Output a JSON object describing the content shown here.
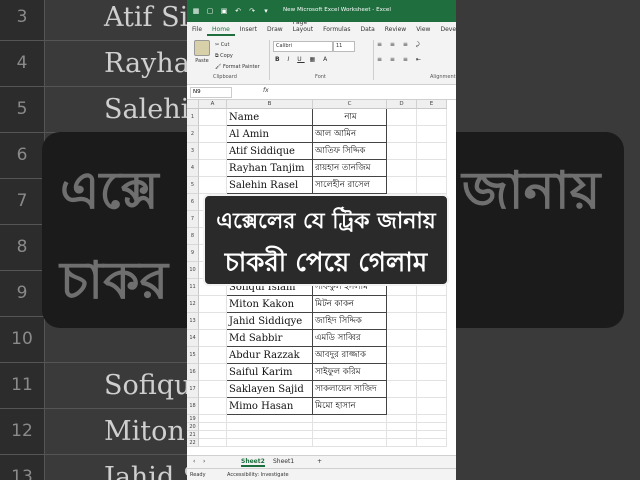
{
  "window": {
    "title": "New Microsoft Excel Worksheet - Excel",
    "menu": [
      "File",
      "Home",
      "Insert",
      "Draw",
      "Page Layout",
      "Formulas",
      "Data",
      "Review",
      "View",
      "Develo"
    ],
    "active_menu": "Home"
  },
  "ribbon": {
    "paste": "Paste",
    "cut": "Cut",
    "copy": "Copy",
    "format_painter": "Format Painter",
    "clipboard_label": "Clipboard",
    "font_name": "Calibri",
    "font_size": "11",
    "font_label": "Font",
    "alignment_label": "Alignment"
  },
  "formula_bar": {
    "name_box": "N9",
    "fx": "fx",
    "value": ""
  },
  "columns": [
    "A",
    "B",
    "C",
    "D",
    "E"
  ],
  "rows": [
    {
      "n": "1",
      "name": "Name",
      "bn": "নাম"
    },
    {
      "n": "2",
      "name": "Al Amin",
      "bn": "আল আমিন"
    },
    {
      "n": "3",
      "name": "Atif Siddique",
      "bn": "আতিফ সিদ্দিক"
    },
    {
      "n": "4",
      "name": "Rayhan Tanjim",
      "bn": "রায়হান তানজিম"
    },
    {
      "n": "5",
      "name": "Salehin Rasel",
      "bn": "সালেহীন রাসেল"
    },
    {
      "n": "6",
      "name": "",
      "bn": ""
    },
    {
      "n": "7",
      "name": "",
      "bn": ""
    },
    {
      "n": "8",
      "name": "",
      "bn": ""
    },
    {
      "n": "9",
      "name": "",
      "bn": ""
    },
    {
      "n": "10",
      "name": "",
      "bn": ""
    },
    {
      "n": "11",
      "name": "Sofiqul Islam",
      "bn": "সফিকুল ইসলাম"
    },
    {
      "n": "12",
      "name": "Miton Kakon",
      "bn": "মিটন কাকন"
    },
    {
      "n": "13",
      "name": "Jahid Siddiqye",
      "bn": "জাহিদ সিদ্দিক"
    },
    {
      "n": "14",
      "name": "Md Sabbir",
      "bn": "এমডি সাব্বির"
    },
    {
      "n": "15",
      "name": "Abdur Razzak",
      "bn": "আবদুর রাজ্জাক"
    },
    {
      "n": "16",
      "name": "Saiful Karim",
      "bn": "সাইফুল করিম"
    },
    {
      "n": "17",
      "name": "Saklayen Sajid",
      "bn": "সাকলায়েন সাজিদ"
    },
    {
      "n": "18",
      "name": "Mimo Hasan",
      "bn": "মিমো হাসান"
    },
    {
      "n": "19",
      "name": "",
      "bn": ""
    },
    {
      "n": "20",
      "name": "",
      "bn": ""
    },
    {
      "n": "21",
      "name": "",
      "bn": ""
    },
    {
      "n": "22",
      "name": "",
      "bn": ""
    }
  ],
  "sheets": [
    "Sheet2",
    "Sheet1"
  ],
  "active_sheet": "Sheet2",
  "add_sheet": "+",
  "status": {
    "ready": "Ready",
    "accessibility": "Accessibility: Investigate"
  },
  "caption": {
    "line1": "এক্সেলের যে ট্রিক জানায়",
    "line2": "চাকরী পেয়ে গেলাম"
  },
  "background": {
    "row_numbers": [
      "3",
      "4",
      "5",
      "6",
      "7",
      "8",
      "9",
      "10",
      "11",
      "12",
      "13"
    ],
    "names": [
      "Atif Sic",
      "Rayhan",
      "Salehin",
      "",
      "",
      "",
      "",
      "",
      "Sofiqu",
      "Miton",
      "Jahid S"
    ],
    "banner_left": "এক্সে",
    "banner_right": "জানায়",
    "banner_bottom": "চাকর          গেলাম"
  }
}
